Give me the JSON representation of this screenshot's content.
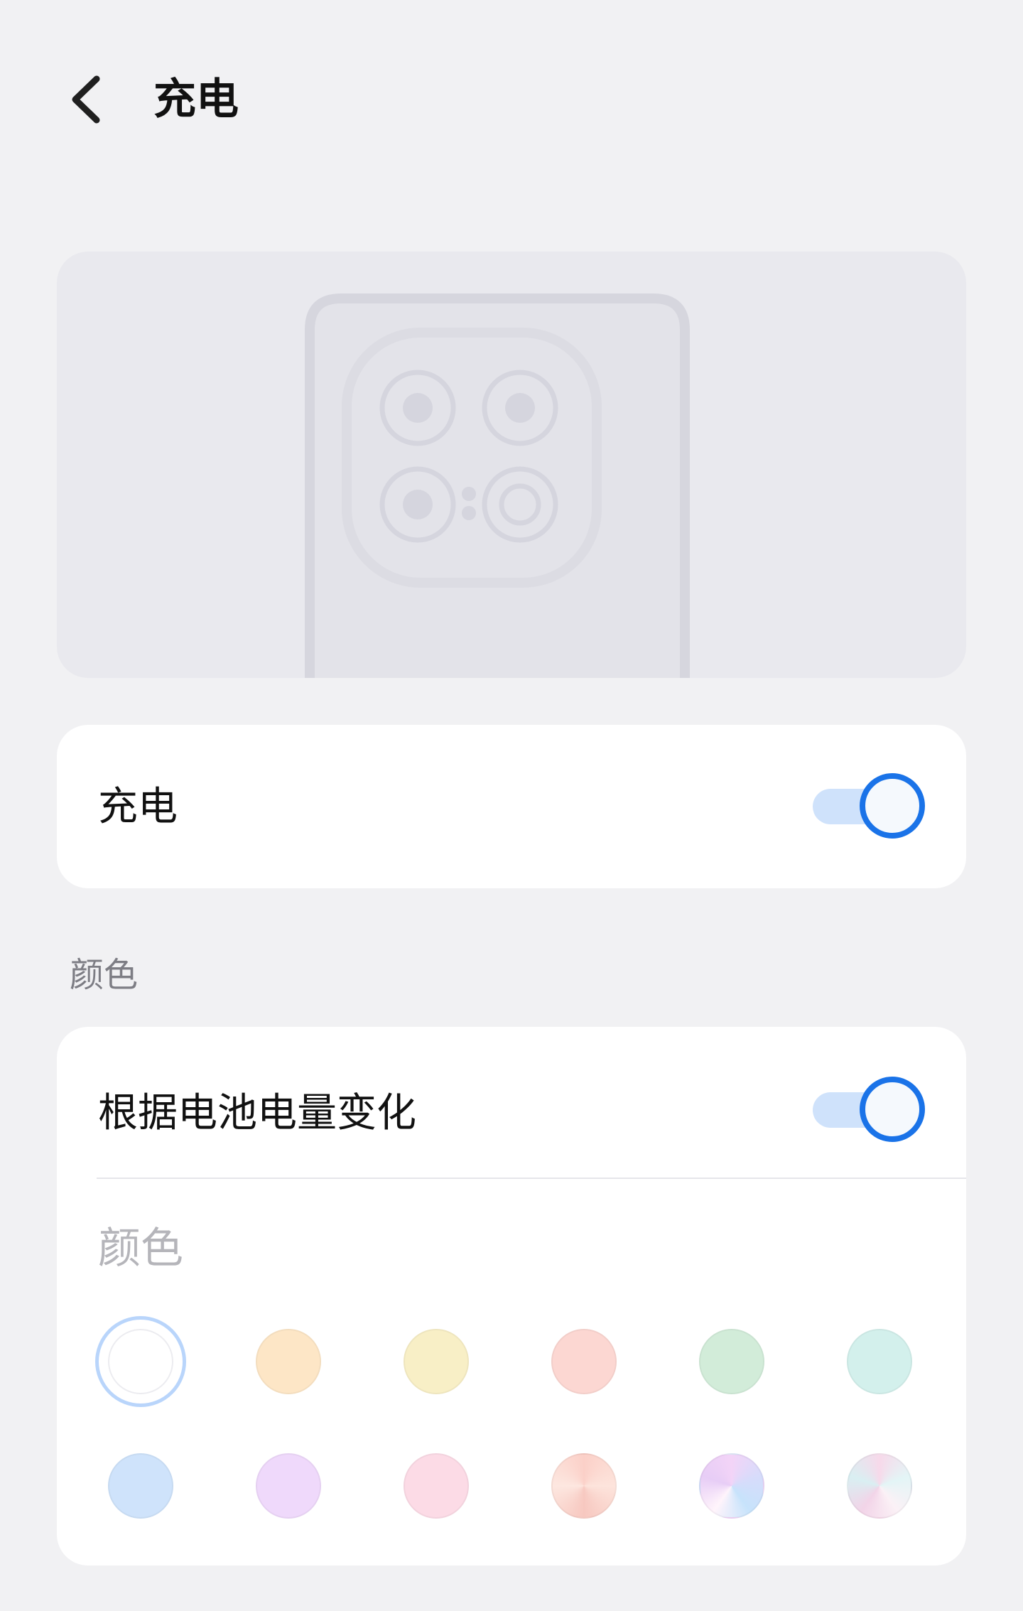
{
  "header": {
    "title": "充电",
    "back_icon": "chevron-left-icon"
  },
  "preview": {
    "image": "phone-rear-camera-illustration"
  },
  "charging_card": {
    "label": "充电",
    "toggle_on": true
  },
  "color_section": {
    "caption": "颜色",
    "battery_row_label": "根据电池电量变化",
    "battery_toggle_on": true,
    "sub_label": "颜色",
    "selected_index": 0,
    "swatches": [
      {
        "name": "white",
        "color": "#ffffff"
      },
      {
        "name": "peach",
        "color": "#fde6c6"
      },
      {
        "name": "cream",
        "color": "#f8efc6"
      },
      {
        "name": "salmon",
        "color": "#fcd7d2"
      },
      {
        "name": "mint",
        "color": "#d2ecd9"
      },
      {
        "name": "aqua",
        "color": "#d3f0ec"
      },
      {
        "name": "sky",
        "color": "#cfe3fb"
      },
      {
        "name": "lavender",
        "color": "#efd9fb"
      },
      {
        "name": "pink",
        "color": "#fcdbe6"
      },
      {
        "name": "coral-gradient",
        "color": "#fbd6cf"
      },
      {
        "name": "rainbow-gradient",
        "color": "#e3dcf8"
      },
      {
        "name": "pastel-gradient",
        "color": "#f4e6f0"
      }
    ]
  },
  "colors": {
    "accent": "#1a73e8",
    "toggle_track": "#cfe2fb",
    "background": "#f1f1f3"
  }
}
